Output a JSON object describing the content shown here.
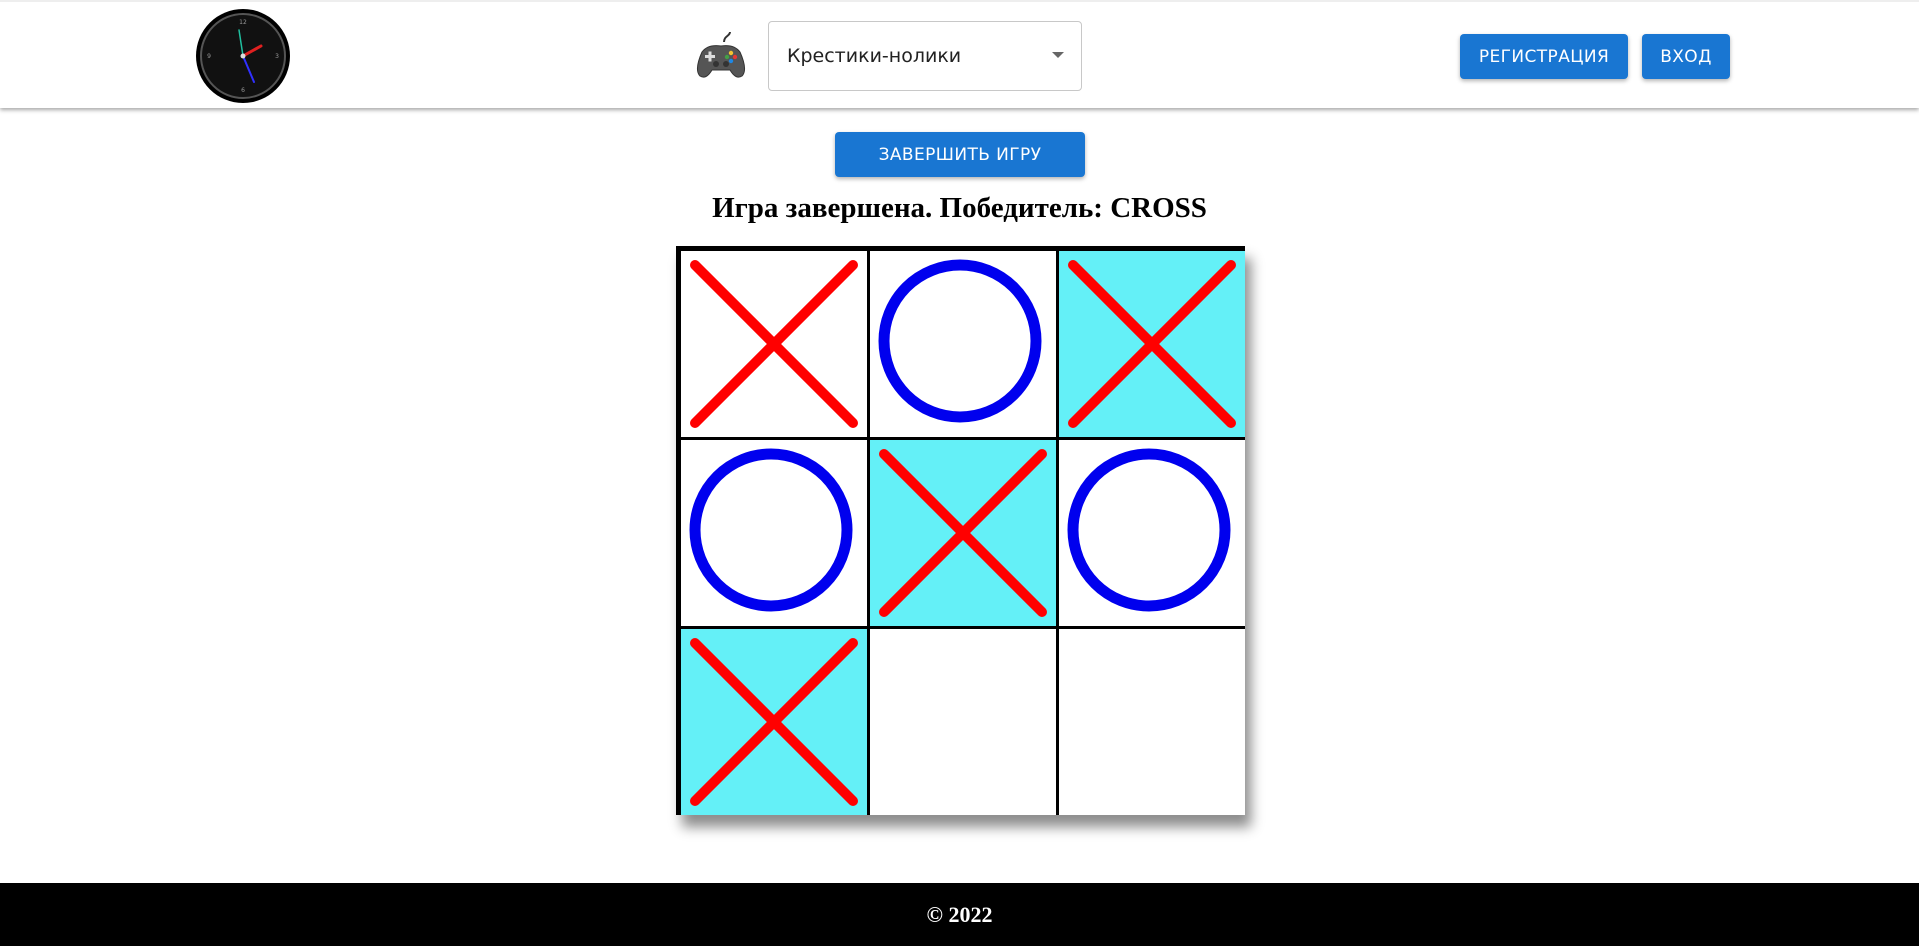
{
  "header": {
    "clock_icon": "analog-clock-icon",
    "game_icon": "gamepad-icon",
    "game_select": {
      "selected": "Крестики-нолики"
    },
    "register_label": "Регистрация",
    "login_label": "Вход"
  },
  "actions": {
    "finish_label": "Завершить игру"
  },
  "status": {
    "text": "Игра завершена. Победитель: CROSS"
  },
  "board": {
    "cells": [
      {
        "mark": "X",
        "winning": false
      },
      {
        "mark": "O",
        "winning": false
      },
      {
        "mark": "X",
        "winning": true
      },
      {
        "mark": "O",
        "winning": false
      },
      {
        "mark": "X",
        "winning": true
      },
      {
        "mark": "O",
        "winning": false
      },
      {
        "mark": "X",
        "winning": true
      },
      {
        "mark": "",
        "winning": false
      },
      {
        "mark": "",
        "winning": false
      }
    ],
    "colors": {
      "cross": "#ff0000",
      "nought": "#0000ee",
      "highlight": "#64f0f7",
      "grid": "#000000"
    }
  },
  "footer": {
    "text": "© 2022"
  }
}
